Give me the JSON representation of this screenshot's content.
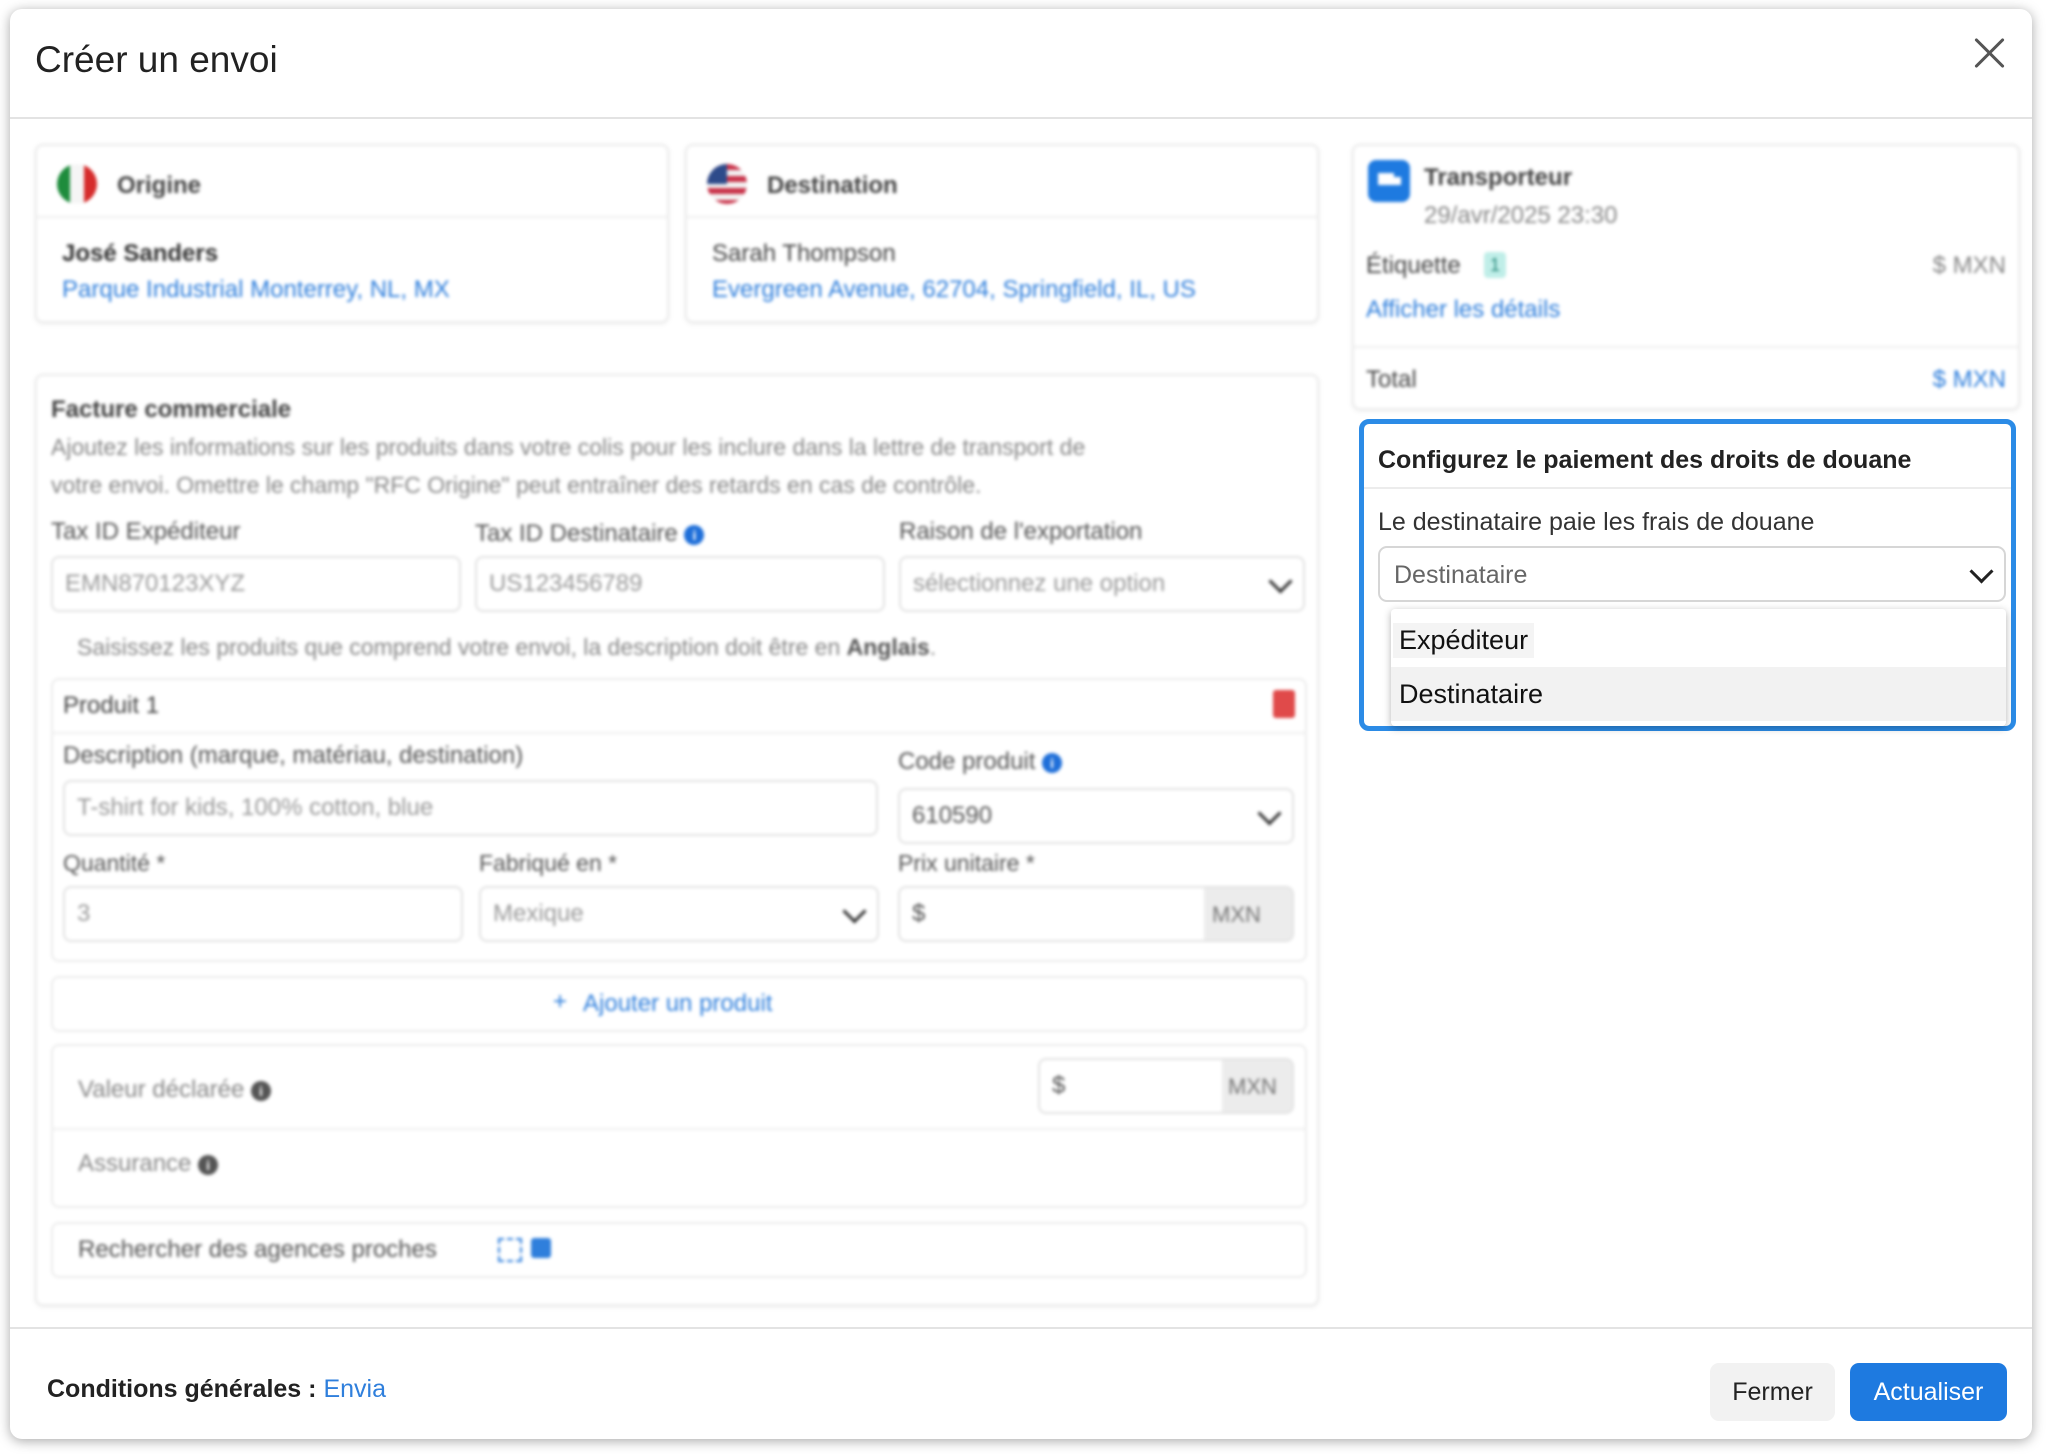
{
  "modal": {
    "title": "Créer un envoi"
  },
  "origin": {
    "title": "Origine",
    "name": "José Sanders",
    "address": "Parque Industrial Monterrey, NL, MX"
  },
  "destination": {
    "title": "Destination",
    "name": "Sarah Thompson",
    "address": "Evergreen Avenue, 62704, Springfield, IL, US"
  },
  "carrier": {
    "title": "Transporteur",
    "date": "29/avr/2025 23:30",
    "label_text": "Étiquette",
    "label_badge": "1",
    "label_amount": "$ MXN",
    "details_link": "Afficher les détails",
    "total_label": "Total",
    "total_value": "$ MXN"
  },
  "customs": {
    "title": "Configurez le paiement des droits de douane",
    "field_label": "Le destinataire paie les frais de douane",
    "selected": "Destinataire",
    "options": [
      "Expéditeur",
      "Destinataire"
    ]
  },
  "invoice": {
    "title": "Facture commerciale",
    "description_line1": "Ajoutez les informations sur les produits dans votre colis pour les inclure dans la lettre de transport de",
    "description_line2": "votre envoi. Omettre le champ \"RFC Origine\" peut entraîner des retards en cas de contrôle.",
    "tax_sender_label": "Tax ID Expéditeur",
    "tax_sender_value": "EMN870123XYZ",
    "tax_recipient_label": "Tax ID Destinataire",
    "tax_recipient_value": "US123456789",
    "export_reason_label": "Raison de l'exportation",
    "export_reason_placeholder": "sélectionnez une option",
    "products_hint_prefix": "Saisissez les produits que comprend votre envoi, la description doit être en",
    "products_hint_bold": "Anglais",
    "products_hint_suffix": "."
  },
  "product": {
    "title": "Produit 1",
    "description_label": "Description (marque, matériau, destination)",
    "description_value": "T-shirt for kids, 100% cotton, blue",
    "code_label": "Code produit",
    "code_value": "610590",
    "quantity_label": "Quantité *",
    "quantity_value": "3",
    "made_in_label": "Fabriqué en *",
    "made_in_value": "Mexique",
    "unit_price_label": "Prix unitaire *",
    "unit_price_prefix": "$",
    "unit_price_currency": "MXN"
  },
  "add_product": {
    "label": "Ajouter un produit"
  },
  "declared": {
    "value_label": "Valeur déclarée",
    "value_prefix": "$",
    "value_currency": "MXN",
    "insurance_label": "Assurance"
  },
  "agencies": {
    "label": "Rechercher des agences proches"
  },
  "footer": {
    "terms_label": "Conditions générales :",
    "terms_link": "Envia",
    "close_button": "Fermer",
    "update_button": "Actualiser"
  }
}
